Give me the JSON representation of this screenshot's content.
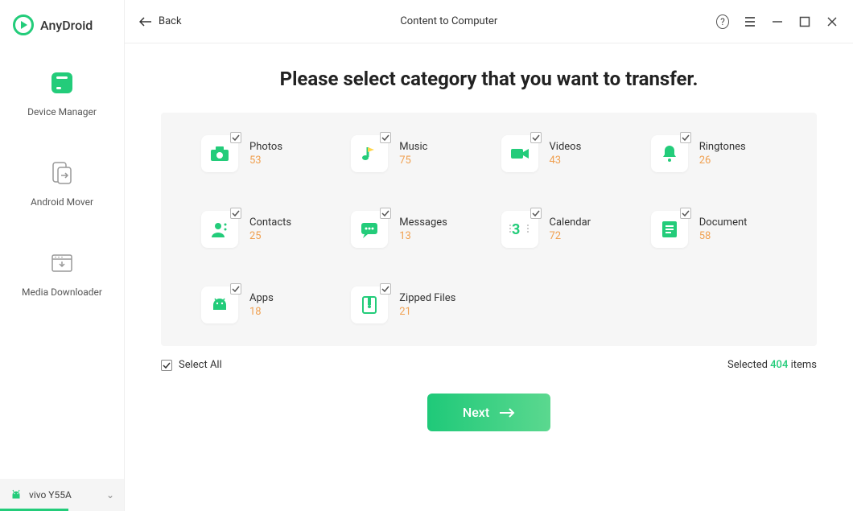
{
  "app": {
    "name": "AnyDroid"
  },
  "sidebar": {
    "items": [
      {
        "label": "Device Manager"
      },
      {
        "label": "Android Mover"
      },
      {
        "label": "Media Downloader"
      }
    ],
    "device": {
      "name": "vivo Y55A"
    }
  },
  "header": {
    "back": "Back",
    "title": "Content to Computer"
  },
  "main": {
    "heading": "Please select category that you want to transfer.",
    "categories": [
      {
        "name": "Photos",
        "count": "53",
        "icon": "camera"
      },
      {
        "name": "Music",
        "count": "75",
        "icon": "music"
      },
      {
        "name": "Videos",
        "count": "43",
        "icon": "video"
      },
      {
        "name": "Ringtones",
        "count": "26",
        "icon": "bell"
      },
      {
        "name": "Contacts",
        "count": "25",
        "icon": "contact"
      },
      {
        "name": "Messages",
        "count": "13",
        "icon": "message"
      },
      {
        "name": "Calendar",
        "count": "72",
        "icon": "calendar"
      },
      {
        "name": "Document",
        "count": "58",
        "icon": "doc"
      },
      {
        "name": "Apps",
        "count": "18",
        "icon": "android"
      },
      {
        "name": "Zipped Files",
        "count": "21",
        "icon": "zip"
      }
    ],
    "select_all": "Select All",
    "selected_prefix": "Selected ",
    "selected_count": "404",
    "selected_suffix": " items",
    "next": "Next"
  }
}
